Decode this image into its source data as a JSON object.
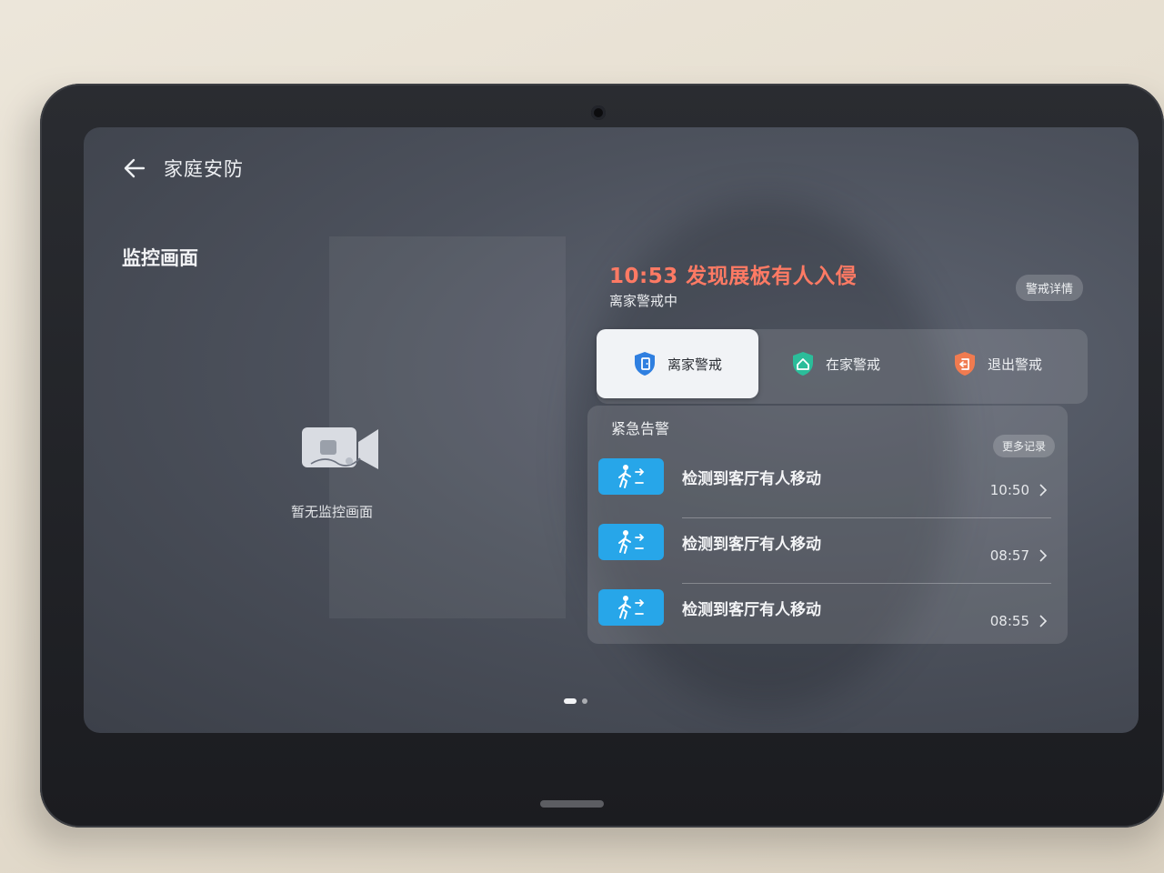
{
  "header": {
    "title": "家庭安防",
    "back_icon": "arrow-left-icon"
  },
  "monitor": {
    "section_title": "监控画面",
    "empty_text": "暂无监控画面",
    "icon": "video-camera-off-icon"
  },
  "alert_banner": {
    "title": "10:53 发现展板有人入侵",
    "status": "离家警戒中",
    "detail_button": "警戒详情",
    "color": "#ff7a64"
  },
  "modes": [
    {
      "label": "离家警戒",
      "icon": "shield-exit-icon",
      "active": true,
      "color": "#2f7fe0"
    },
    {
      "label": "在家警戒",
      "icon": "shield-home-icon",
      "active": false,
      "color": "#2bbd9a"
    },
    {
      "label": "退出警戒",
      "icon": "shield-off-icon",
      "active": false,
      "color": "#f07b50"
    }
  ],
  "emergency": {
    "title": "紧急告警",
    "more_button": "更多记录",
    "items": [
      {
        "text": "检测到客厅有人移动",
        "time": "10:50",
        "icon": "person-walking-icon"
      },
      {
        "text": "检测到客厅有人移动",
        "time": "08:57",
        "icon": "person-walking-icon"
      },
      {
        "text": "检测到客厅有人移动",
        "time": "08:55",
        "icon": "person-walking-icon"
      }
    ],
    "icon_color": "#27a6e9"
  },
  "pager": {
    "pages": 2,
    "current": 1
  }
}
